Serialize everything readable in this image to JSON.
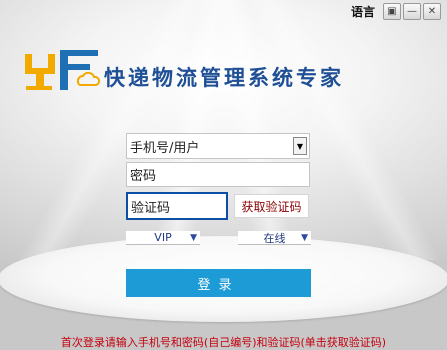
{
  "window": {
    "language_label": "语言",
    "icons": [
      "restore-icon",
      "minimize-icon",
      "close-icon"
    ]
  },
  "app": {
    "title": "快递物流管理系统专家"
  },
  "form": {
    "username_placeholder": "手机号/用户",
    "password_placeholder": "密码",
    "code_placeholder": "验证码",
    "get_code_label": "获取验证码",
    "vip_value": "VIP",
    "status_value": "在线",
    "login_label": "登录",
    "hint": "首次登录请输入手机号和密码(自己编号)和验证码(单击获取验证码)"
  },
  "colors": {
    "title": "#1f4f95",
    "login_button": "#1d9bd7",
    "hint": "#c4000e",
    "logo_orange": "#f2a900",
    "logo_blue": "#1f6fb5"
  }
}
